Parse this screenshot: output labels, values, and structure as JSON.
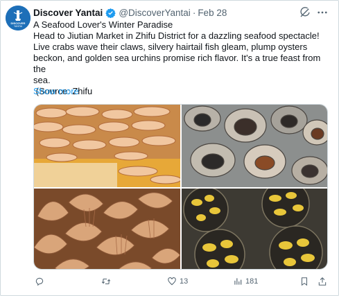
{
  "tweet": {
    "display_name": "Discover Yantai",
    "handle": "@DiscoverYantai",
    "separator": "·",
    "date": "Feb 28",
    "avatar_text_top": "DISCOVER",
    "avatar_text_bottom": "YANTAI",
    "lines": [
      "A Seafood Lover's Winter Paradise",
      "Head to Jiutian Market in Zhifu District for a dazzling seafood spectacle!",
      "Live crabs wave their claws, silvery hairtail fish gleam, plump oysters",
      "beckon, and golden sea urchins promise rich flavor. It's a true feast from the",
      "sea.",
      " (Source: Zhifu"
    ],
    "show_more": "Show more"
  },
  "photos": [
    {
      "subject": "shrimp",
      "icon": "shrimp-photo"
    },
    {
      "subject": "whelks",
      "icon": "whelk-photo"
    },
    {
      "subject": "scallops",
      "icon": "scallop-photo"
    },
    {
      "subject": "sea urchins",
      "icon": "sea-urchin-photo"
    }
  ],
  "actions": {
    "reply_count": "",
    "retweet_count": "",
    "like_count": "13",
    "views_count": "181"
  },
  "colors": {
    "link": "#1d9bf0",
    "muted": "#536471",
    "verified": "#1d9bf0",
    "avatar": "#1d6fb8"
  }
}
